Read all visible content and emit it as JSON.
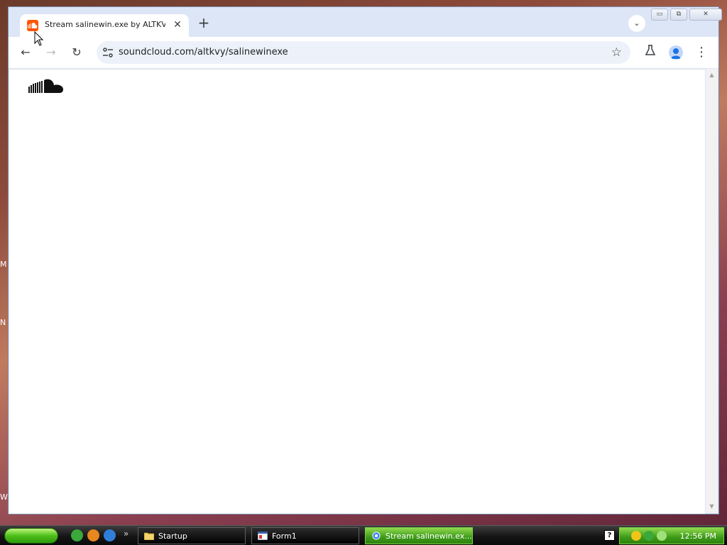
{
  "desktop": {
    "side_chars": [
      "M",
      "N",
      "W"
    ]
  },
  "browser": {
    "tab": {
      "title": "Stream salinewin.exe by ALTKVY |",
      "close_glyph": "✕"
    },
    "new_tab_glyph": "+",
    "tab_search_glyph": "⌄",
    "window_buttons": {
      "minimize": "▭",
      "maximize": "⧉",
      "close": "✕"
    },
    "toolbar": {
      "back_glyph": "←",
      "forward_glyph": "→",
      "reload_glyph": "↻",
      "url": "soundcloud.com/altkvy/salinewinexe",
      "star_glyph": "☆",
      "labs_glyph": "⚗",
      "menu_glyph": "⋮"
    },
    "page": {
      "logo_name": "soundcloud-logo"
    },
    "scrollbar": {
      "up": "▲",
      "down": "▼"
    }
  },
  "taskbar": {
    "quick_launch_more": "»",
    "tasks": [
      {
        "label": "Startup",
        "icon": "folder-icon",
        "active": false
      },
      {
        "label": "Form1",
        "icon": "form-icon",
        "active": false
      },
      {
        "label": "Stream salinewin.ex...",
        "icon": "chrome-icon",
        "active": true
      }
    ],
    "help_glyph": "?",
    "clock": "12:56 PM"
  },
  "colors": {
    "soundcloud_orange": "#ff5500",
    "taskbar_green": "#3c9a17",
    "chrome_frame": "#dde6f7",
    "omnibox": "#edf2fa"
  }
}
